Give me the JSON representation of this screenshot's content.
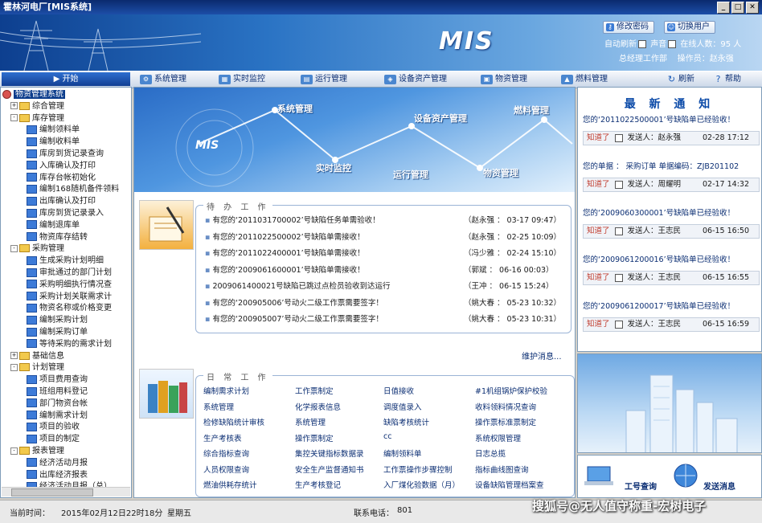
{
  "window": {
    "title": "霍林河电厂[MIS系统]"
  },
  "header": {
    "logo": "MIS",
    "btn_change_pwd": "修改密码",
    "btn_switch_user": "切换用户",
    "auto_refresh": "自动刷新",
    "sound": "声音",
    "online_label": "在线人数：",
    "online_count": "95",
    "online_unit": "人",
    "dept": "总经理工作部",
    "operator_label": "操作员：",
    "operator": "赵永强"
  },
  "nav": {
    "start": "开始",
    "items": [
      "系统管理",
      "实时监控",
      "运行管理",
      "设备资产管理",
      "物资管理",
      "燃料管理"
    ],
    "refresh": "刷新",
    "help": "帮助"
  },
  "tree": [
    {
      "label": "物资管理系统",
      "level": 0,
      "kind": "root"
    },
    {
      "label": "综合管理",
      "level": 1,
      "kind": "folder",
      "exp": "+"
    },
    {
      "label": "库存管理",
      "level": 1,
      "kind": "folder",
      "exp": "-"
    },
    {
      "label": "编制领料单",
      "level": 2,
      "kind": "doc"
    },
    {
      "label": "编制收料单",
      "level": 2,
      "kind": "doc"
    },
    {
      "label": "库房到货记录查询",
      "level": 2,
      "kind": "doc"
    },
    {
      "label": "入库确认及打印",
      "level": 2,
      "kind": "doc"
    },
    {
      "label": "库存台帐初始化",
      "level": 2,
      "kind": "doc"
    },
    {
      "label": "编制168随机备件领料",
      "level": 2,
      "kind": "doc"
    },
    {
      "label": "出库确认及打印",
      "level": 2,
      "kind": "doc"
    },
    {
      "label": "库房到货记录录入",
      "level": 2,
      "kind": "doc"
    },
    {
      "label": "编制退库单",
      "level": 2,
      "kind": "doc"
    },
    {
      "label": "物资库存结转",
      "level": 2,
      "kind": "doc"
    },
    {
      "label": "采购管理",
      "level": 1,
      "kind": "folder",
      "exp": "-"
    },
    {
      "label": "生成采购计划明细",
      "level": 2,
      "kind": "doc"
    },
    {
      "label": "审批通过的部门计划",
      "level": 2,
      "kind": "doc"
    },
    {
      "label": "采购明细执行情况查",
      "level": 2,
      "kind": "doc"
    },
    {
      "label": "采购计划关联需求计",
      "level": 2,
      "kind": "doc"
    },
    {
      "label": "物资名称或价格变更",
      "level": 2,
      "kind": "doc"
    },
    {
      "label": "编制采购计划",
      "level": 2,
      "kind": "doc"
    },
    {
      "label": "编制采购订单",
      "level": 2,
      "kind": "doc"
    },
    {
      "label": "等待采购的需求计划",
      "level": 2,
      "kind": "doc"
    },
    {
      "label": "基础信息",
      "level": 1,
      "kind": "folder",
      "exp": "+"
    },
    {
      "label": "计划管理",
      "level": 1,
      "kind": "folder",
      "exp": "-"
    },
    {
      "label": "项目费用查询",
      "level": 2,
      "kind": "doc"
    },
    {
      "label": "班组用料登记",
      "level": 2,
      "kind": "doc"
    },
    {
      "label": "部门物资台帐",
      "level": 2,
      "kind": "doc"
    },
    {
      "label": "编制需求计划",
      "level": 2,
      "kind": "doc"
    },
    {
      "label": "项目的验收",
      "level": 2,
      "kind": "doc"
    },
    {
      "label": "项目的制定",
      "level": 2,
      "kind": "doc"
    },
    {
      "label": "报表管理",
      "level": 1,
      "kind": "folder",
      "exp": "-"
    },
    {
      "label": "经济活动月报",
      "level": 2,
      "kind": "doc"
    },
    {
      "label": "出库经济报表",
      "level": 2,
      "kind": "doc"
    },
    {
      "label": "经济活动月报（总）",
      "level": 2,
      "kind": "doc"
    }
  ],
  "banner": {
    "logo": "MIS",
    "labels": [
      "系统管理",
      "实时监控",
      "设备资产管理",
      "运行管理",
      "燃料管理",
      "物资管理"
    ]
  },
  "todo": {
    "title": "待 办 工 作",
    "items": [
      {
        "text": "有您的‘2011031700002’号缺陷任务单需验收！",
        "meta": "（赵永强 ： 03-17 09:47）"
      },
      {
        "text": "有您的‘2011022500002’号缺陷单需接收！",
        "meta": "（赵永强 ： 02-25 10:09）"
      },
      {
        "text": "有您的‘2011022400001’号缺陷单需接收！",
        "meta": "（冯少雅 ： 02-24 15:10）"
      },
      {
        "text": "有您的‘2009061600001’号缺陷单需接收！",
        "meta": "（郭斌   ： 06-16 00:03）"
      },
      {
        "text": "2009061400021号缺陷已跳过点检员验收到达运行",
        "meta": "（王冲   ： 06-15 15:24）"
      },
      {
        "text": "有您的‘200905006’号动火二级工作票需要签字！",
        "meta": "（姚大春 ： 05-23 10:32）"
      },
      {
        "text": "有您的‘200905007’号动火二级工作票需要签字！",
        "meta": "（姚大春 ： 05-23 10:31）"
      }
    ],
    "more": "维护消息..."
  },
  "daily": {
    "title": "日 常 工 作",
    "columns": [
      [
        "编制需求计划",
        "系统管理",
        "检修缺陷统计审核",
        "生产考核表",
        "综合指标查询",
        "人员权限查询",
        "燃油供耗存统计"
      ],
      [
        "工作票制定",
        "化学报表信息",
        "系统管理",
        "操作票制定",
        "集控关键指标数据录",
        "安全生产监督通知书",
        "生产考核登记"
      ],
      [
        "日值接收",
        "调度值录入",
        "缺陷考核统计",
        "cc",
        "编制领料单",
        "工作票操作步骤控制",
        "入厂煤化验数据（月）"
      ],
      [
        "#1机组锅炉保护校验",
        "收料领料情况查询",
        "操作票标准票制定",
        "系统权限管理",
        "日志总揽",
        "指标曲线图查询",
        "设备缺陷管理档案查"
      ]
    ]
  },
  "notice": {
    "title": "最 新 通 知",
    "items": [
      {
        "msg": "您的‘2011022500001’号缺陷单已经验收！",
        "ack": "知道了",
        "sender_label": "发送人：",
        "sender": "赵永强",
        "time": "02-28 17:12"
      },
      {
        "msg": "您的单据 ： 采购订单 单据编码：ZJB201102",
        "ack": "知道了",
        "sender_label": "发送人：",
        "sender": "周耀明",
        "time": "02-17 14:32"
      },
      {
        "msg": "您的‘2009060300001’号缺陷单已经验收！",
        "ack": "知道了",
        "sender_label": "发送人：",
        "sender": "王志民",
        "time": "06-15 16:50"
      },
      {
        "msg": "您的‘2009061200016’号缺陷单已经验收！",
        "ack": "知道了",
        "sender_label": "发送人：",
        "sender": "王志民",
        "time": "06-15 16:55"
      },
      {
        "msg": "您的‘2009061200017’号缺陷单已经验收！",
        "ack": "知道了",
        "sender_label": "发送人：",
        "sender": "王志民",
        "time": "06-15 16:59"
      }
    ]
  },
  "quick": {
    "work_query": "工号查询",
    "send_msg": "发送消息"
  },
  "status": {
    "time_label": "当前时间：",
    "time": "2015年02月12日22时18分",
    "weekday": "星期五",
    "phone_label": "联系电话：",
    "phone": "801"
  },
  "watermark": "搜狐号@无人值守称重-宏树电子"
}
